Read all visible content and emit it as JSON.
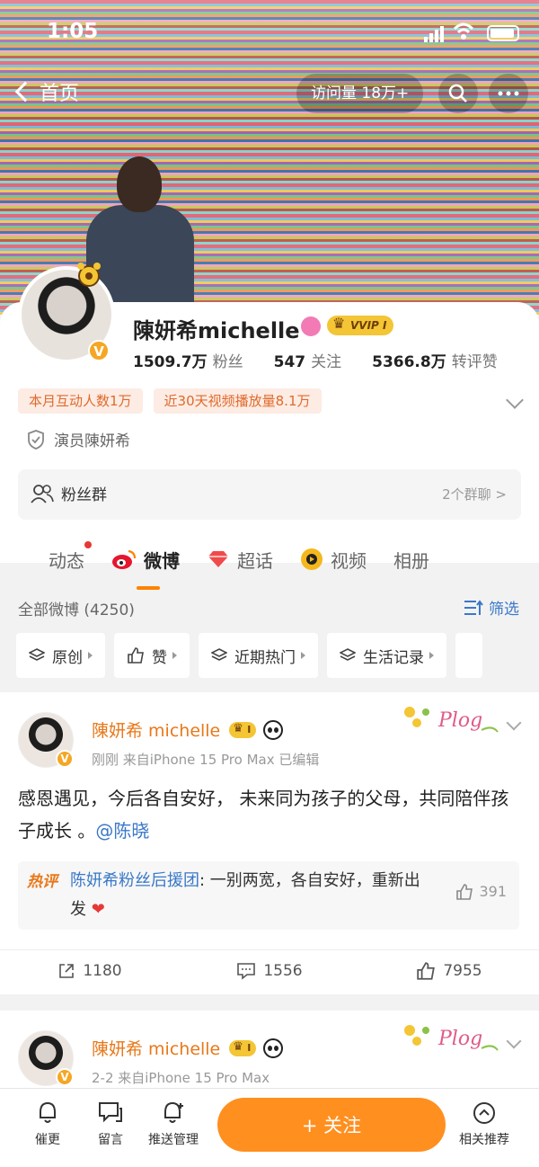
{
  "status_bar": {
    "time": "1:05"
  },
  "nav": {
    "back_label": "首页",
    "visits": "访问量 18万+"
  },
  "profile": {
    "name": "陳妍希michelle",
    "vip_label": "VVIP I",
    "verified_badge": "V",
    "stats": [
      {
        "num": "1509.7万",
        "label": "粉丝"
      },
      {
        "num": "547",
        "label": "关注"
      },
      {
        "num": "5366.8万",
        "label": "转评赞"
      }
    ],
    "tags": [
      "本月互动人数1万",
      "近30天视频播放量8.1万"
    ],
    "verification": "演员陳妍希",
    "fan_group": {
      "label": "粉丝群",
      "count": "2个群聊 >"
    }
  },
  "tabs": [
    {
      "label": "动态"
    },
    {
      "label": "微博"
    },
    {
      "label": "超话"
    },
    {
      "label": "视频"
    },
    {
      "label": "相册"
    }
  ],
  "filters": {
    "all": "全部微博 (4250)",
    "sift": "筛选",
    "chips": [
      "原创",
      "赞",
      "近期热门",
      "生活记录"
    ]
  },
  "posts": [
    {
      "name": "陳妍希 michelle",
      "crown_label": "I",
      "meta": "刚刚  来自iPhone 15 Pro Max  已编辑",
      "text_main": "感恩遇见，今后各自安好，  未来同为孩子的父母，共同陪伴孩子成长 。",
      "mention": "@陈晓",
      "hot_tag": "热评",
      "hot_source": "陈妍希粉丝后援团",
      "hot_text": ": 一别两宽，各自安好，重新出发",
      "hot_likes": "391",
      "reposts": "1180",
      "comments": "1556",
      "likes": "7955",
      "plog": "Plog"
    },
    {
      "name": "陳妍希 michelle",
      "crown_label": "I",
      "meta": "2-2  来自iPhone 15 Pro Max",
      "plog": "Plog"
    }
  ],
  "bottom_bar": {
    "items": [
      "催更",
      "留言",
      "推送管理",
      "相关推荐"
    ],
    "follow": "+ 关注"
  },
  "colors": {
    "accent": "#ff8200",
    "link": "#3a78c8",
    "vip_gold": "#f4c534"
  }
}
